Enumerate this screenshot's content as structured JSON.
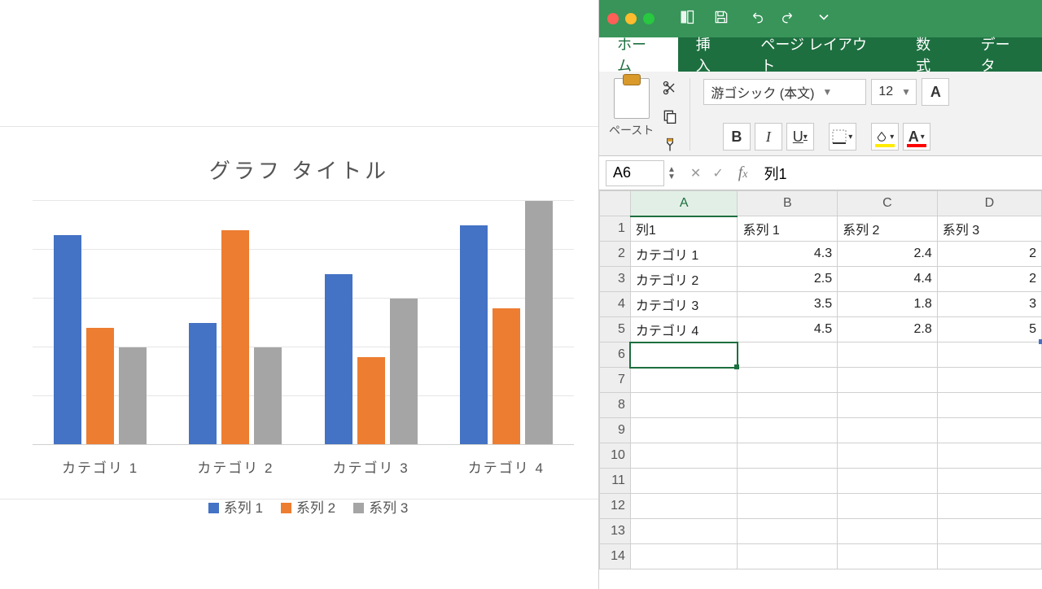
{
  "chart_data": {
    "type": "bar",
    "title": "グラフ タイトル",
    "categories": [
      "カテゴリ 1",
      "カテゴリ 2",
      "カテゴリ 3",
      "カテゴリ 4"
    ],
    "series": [
      {
        "name": "系列 1",
        "values": [
          4.3,
          2.5,
          3.5,
          4.5
        ],
        "color": "#4472C4"
      },
      {
        "name": "系列 2",
        "values": [
          2.4,
          4.4,
          1.8,
          2.8
        ],
        "color": "#ED7D31"
      },
      {
        "name": "系列 3",
        "values": [
          2,
          2,
          3,
          5
        ],
        "color": "#A5A5A5"
      }
    ],
    "ylim": [
      0,
      5
    ],
    "gridlines": 5,
    "xlabel": "",
    "ylabel": ""
  },
  "excel": {
    "tabs": {
      "home": "ホーム",
      "insert": "挿入",
      "pageLayout": "ページ レイアウト",
      "formulas": "数式",
      "data": "データ"
    },
    "paste_label": "ペースト",
    "font_name": "游ゴシック (本文)",
    "font_size": "12",
    "name_box": "A6",
    "formula_value": "列1",
    "columns": [
      "A",
      "B",
      "C",
      "D"
    ],
    "row_count": 14,
    "selected": {
      "row": 6,
      "col": "A"
    },
    "table": {
      "header": [
        "列1",
        "系列 1",
        "系列 2",
        "系列 3"
      ],
      "rows": [
        {
          "label": "カテゴリ 1",
          "v": [
            4.3,
            2.4,
            2
          ]
        },
        {
          "label": "カテゴリ 2",
          "v": [
            2.5,
            4.4,
            2
          ]
        },
        {
          "label": "カテゴリ 3",
          "v": [
            3.5,
            1.8,
            3
          ]
        },
        {
          "label": "カテゴリ 4",
          "v": [
            4.5,
            2.8,
            5
          ]
        }
      ]
    }
  }
}
